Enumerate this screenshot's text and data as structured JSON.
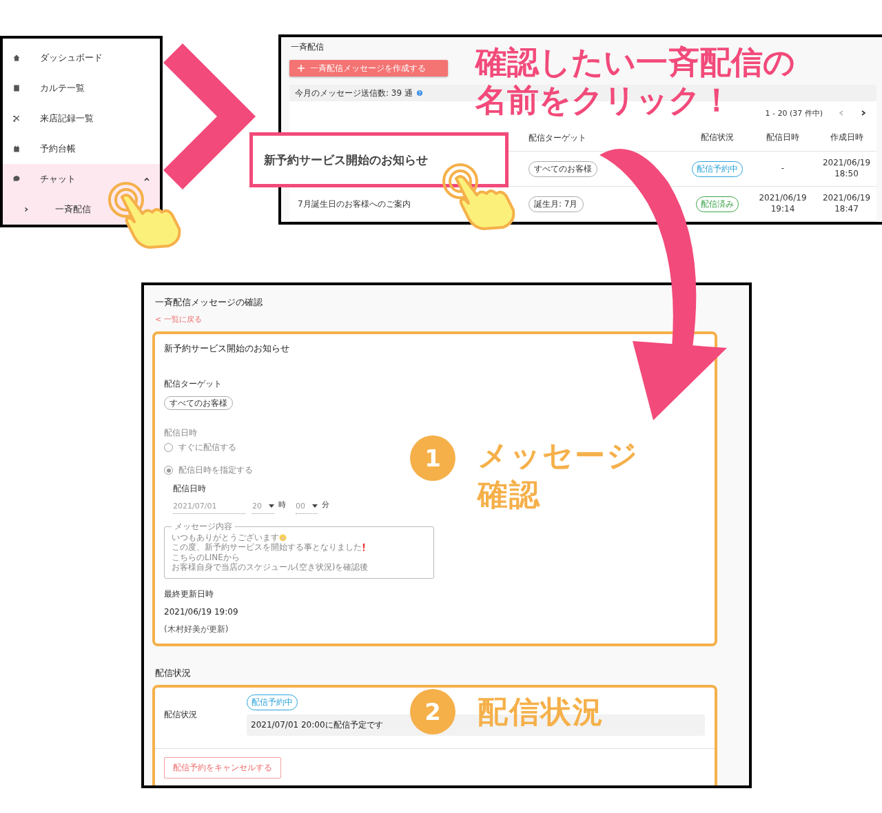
{
  "sidebar": {
    "items": [
      {
        "label": "ダッシュボード",
        "selected": false
      },
      {
        "label": "カルテ一覧",
        "selected": false
      },
      {
        "label": "来店記録一覧",
        "selected": false
      },
      {
        "label": "予約台帳",
        "selected": false
      },
      {
        "label": "チャット",
        "selected": true,
        "children": [
          {
            "label": "一斉配信"
          }
        ]
      }
    ]
  },
  "list_panel": {
    "title": "一斉配信",
    "create_button": "一斉配信メッセージを作成する",
    "monthly_count": "今月のメッセージ送信数: 39 通",
    "pagination": "1 - 20 (37 件中)",
    "columns": [
      "配信ターゲット",
      "配信状況",
      "配信日時",
      "作成日時"
    ],
    "rows": [
      {
        "target": "すべてのお客様",
        "status": "配信予約中",
        "color": "#29a3d9",
        "sent_at": "-",
        "created_at": "2021/06/19 18:50"
      },
      {
        "name": "7月誕生日のお客様へのご案内",
        "target": "誕生月: 7月",
        "status": "配信済み",
        "color": "#3aa346",
        "sent_at": "2021/06/19 19:14",
        "created_at": "2021/06/19 18:47"
      }
    ]
  },
  "callout": {
    "text": "新予約サービス開始のお知らせ"
  },
  "headline": {
    "lines": [
      "確認したい一斉配信の",
      "名前をクリック！"
    ]
  },
  "detail": {
    "title": "一斉配信メッセージの確認",
    "back_link": "< 一覧に戻る",
    "message_card": {
      "title": "新予約サービス開始のお知らせ",
      "target_label": "配信ターゲット",
      "target": "すべてのお客様",
      "schedule_label": "配信日時",
      "options": [
        {
          "label": "すぐに配信する",
          "selected": false
        },
        {
          "label": "配信日時を指定する",
          "selected": true
        }
      ],
      "date_label": "配信日時",
      "date": "2021/07/01",
      "hour": "20",
      "hour_unit": "時",
      "minute": "00",
      "minute_unit": "分",
      "message_label": "メッセージ内容",
      "message_lines": [
        {
          "text": "いつもありがとうございます",
          "kind": "smile"
        },
        {
          "text": "この度、新予約サービスを開始する事となりました",
          "kind": "exclaim"
        },
        {
          "text": "こちらのLINEから",
          "kind": "plain"
        },
        {
          "text": "お客様自身で当店のスケジュール(空き状況)を確認後",
          "kind": "plain"
        }
      ],
      "updated_label": "最終更新日時",
      "updated_at": "2021/06/19 19:09",
      "updated_by": "(木村好美が更新)"
    },
    "status_section": {
      "title": "配信状況",
      "label": "配信状況",
      "status": "配信予約中",
      "color": "#29a3d9",
      "note": "2021/07/01 20:00に配信予定です",
      "cancel_button": "配信予約をキャンセルする"
    }
  },
  "annotations": [
    {
      "number": "1",
      "lines": [
        "メッセージ",
        "確認"
      ]
    },
    {
      "number": "2",
      "lines": [
        "配信状況"
      ]
    }
  ]
}
